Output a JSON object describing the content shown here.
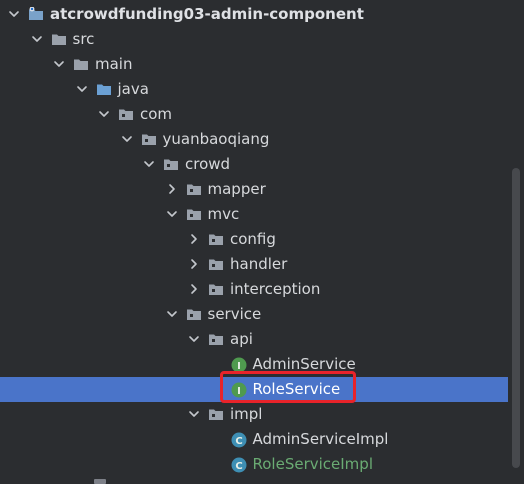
{
  "colors": {
    "background": "#2b2d30",
    "selection": "#4a74c9",
    "folder": "#9aa1ab",
    "module_folder": "#7aa2c9",
    "source_folder": "#6ba0d4",
    "interface_icon": "#4f9a4f",
    "class_icon": "#3e8fb4",
    "highlight_box": "#e8232a",
    "green_text": "#6aab73"
  },
  "tree": [
    {
      "label": "atcrowdfunding03-admin-component",
      "depth": 0,
      "expanded": true,
      "icon": "module-folder-icon",
      "bold": true
    },
    {
      "label": "src",
      "depth": 1,
      "expanded": true,
      "icon": "folder-icon"
    },
    {
      "label": "main",
      "depth": 2,
      "expanded": true,
      "icon": "folder-icon"
    },
    {
      "label": "java",
      "depth": 3,
      "expanded": true,
      "icon": "source-folder-icon"
    },
    {
      "label": "com",
      "depth": 4,
      "expanded": true,
      "icon": "package-icon"
    },
    {
      "label": "yuanbaoqiang",
      "depth": 5,
      "expanded": true,
      "icon": "package-icon"
    },
    {
      "label": "crowd",
      "depth": 6,
      "expanded": true,
      "icon": "package-icon"
    },
    {
      "label": "mapper",
      "depth": 7,
      "expanded": false,
      "icon": "package-icon"
    },
    {
      "label": "mvc",
      "depth": 7,
      "expanded": true,
      "icon": "package-icon"
    },
    {
      "label": "config",
      "depth": 8,
      "expanded": false,
      "icon": "package-icon"
    },
    {
      "label": "handler",
      "depth": 8,
      "expanded": false,
      "icon": "package-icon"
    },
    {
      "label": "interception",
      "depth": 8,
      "expanded": false,
      "icon": "package-icon"
    },
    {
      "label": "service",
      "depth": 7,
      "expanded": true,
      "icon": "package-icon"
    },
    {
      "label": "api",
      "depth": 8,
      "expanded": true,
      "icon": "package-icon"
    },
    {
      "label": "AdminService",
      "depth": 9,
      "icon": "interface-icon"
    },
    {
      "label": "RoleService",
      "depth": 9,
      "icon": "interface-icon",
      "selected": true,
      "highlighted": true
    },
    {
      "label": "impl",
      "depth": 8,
      "expanded": true,
      "icon": "package-icon"
    },
    {
      "label": "AdminServiceImpl",
      "depth": 9,
      "icon": "class-icon"
    },
    {
      "label": "RoleServiceImpl",
      "depth": 9,
      "icon": "class-icon",
      "green": true
    }
  ]
}
